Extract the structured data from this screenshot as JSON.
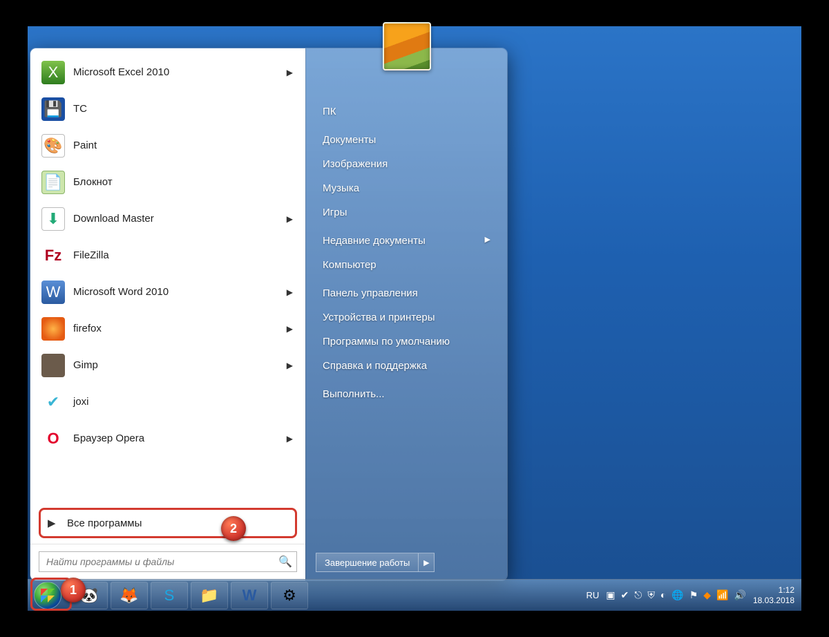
{
  "start_menu": {
    "programs": [
      {
        "label": "Microsoft Excel 2010",
        "has_submenu": true,
        "icon": "X",
        "icon_cls": "ic-excel"
      },
      {
        "label": "TC",
        "has_submenu": false,
        "icon": "💾",
        "icon_cls": "ic-tc"
      },
      {
        "label": "Paint",
        "has_submenu": false,
        "icon": "🎨",
        "icon_cls": "ic-paint"
      },
      {
        "label": "Блокнот",
        "has_submenu": false,
        "icon": "📄",
        "icon_cls": "ic-notepad"
      },
      {
        "label": "Download Master",
        "has_submenu": true,
        "icon": "⬇",
        "icon_cls": "ic-dm"
      },
      {
        "label": "FileZilla",
        "has_submenu": false,
        "icon": "Fz",
        "icon_cls": "ic-fz"
      },
      {
        "label": "Microsoft Word 2010",
        "has_submenu": true,
        "icon": "W",
        "icon_cls": "ic-word"
      },
      {
        "label": "firefox",
        "has_submenu": true,
        "icon": "",
        "icon_cls": "ic-ff"
      },
      {
        "label": "Gimp",
        "has_submenu": true,
        "icon": "",
        "icon_cls": "ic-gimp"
      },
      {
        "label": "joxi",
        "has_submenu": false,
        "icon": "✔",
        "icon_cls": "ic-joxi"
      },
      {
        "label": "Браузер Opera",
        "has_submenu": true,
        "icon": "O",
        "icon_cls": "ic-opera"
      }
    ],
    "all_programs": "Все программы",
    "search_placeholder": "Найти программы и файлы",
    "right_links": [
      {
        "label": "ПК"
      },
      {
        "label": "Документы"
      },
      {
        "label": "Изображения"
      },
      {
        "label": "Музыка"
      },
      {
        "label": "Игры"
      },
      {
        "label": "Недавние документы",
        "has_submenu": true
      },
      {
        "label": "Компьютер"
      },
      {
        "label": "Панель управления"
      },
      {
        "label": "Устройства и принтеры"
      },
      {
        "label": "Программы по умолчанию"
      },
      {
        "label": "Справка и поддержка"
      },
      {
        "label": "Выполнить..."
      }
    ],
    "shutdown": "Завершение работы"
  },
  "taskbar": {
    "lang": "RU",
    "time": "1:12",
    "date": "18.03.2018"
  },
  "callouts": {
    "one": "1",
    "two": "2"
  }
}
